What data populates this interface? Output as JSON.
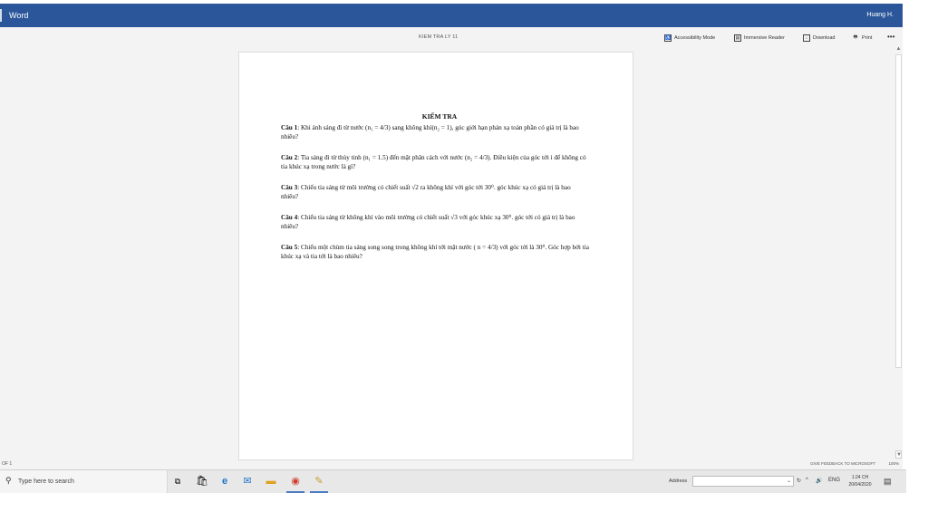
{
  "titlebar": {
    "app_name": "Word",
    "user_name": "Huang H."
  },
  "document": {
    "filename": "KIEM TRA LY 11",
    "heading": "KIỂM TRA",
    "questions": [
      {
        "label": "Câu 1",
        "text": ": Khi ánh sáng đi từ nước (n₁ = 4/3) sang không khí(n₂ = 1), góc giới hạn phản xạ toàn phần có giá trị là bao nhiêu?"
      },
      {
        "label": "Câu 2",
        "text": ": Tia sáng đi từ thủy tinh (n₁ = 1.5) đến mặt phân cách với nước (n₂ = 4/3). Điều kiện của góc tới i để không có tia khúc xạ trong nước là gì?"
      },
      {
        "label": "Câu 3",
        "text": ": Chiếu tia sáng từ môi trường có chiết suất √2 ra không khí với góc tới 30⁰. góc khúc xạ có giá trị là bao nhiêu?"
      },
      {
        "label": "Câu 4",
        "text": ": Chiếu tia sáng từ không khí vào môi trường có chiết suất √3 với góc khúc xạ 30⁰. góc tới có giá trị là bao nhiêu?"
      },
      {
        "label": "Câu 5",
        "text": ": Chiếu một chùm tia sáng song song trong không khí tới mặt nước ( n = 4/3) với góc tới là 30⁰. Góc hợp bởi tia khúc xạ và tia tới là bao nhiêu?"
      }
    ]
  },
  "commands": {
    "accessibility": "Accessibility Mode",
    "immersive": "Immersive Reader",
    "download": "Download",
    "print": "Print",
    "more": "•••"
  },
  "statusbar": {
    "page": "OF 1",
    "feedback": "GIVE FEEDBACK TO MICROSOFT",
    "zoom": "100%"
  },
  "taskbar": {
    "search_placeholder": "Type here to search",
    "address_label": "Address",
    "lang": "ENG",
    "time": "1:24 CH",
    "date": "20/04/2020"
  },
  "icons": {
    "search": "search-icon",
    "task_view": "task-view-icon",
    "store": "store-icon",
    "edge": "edge-icon",
    "mail": "mail-icon",
    "explorer": "file-explorer-icon",
    "chrome": "chrome-icon",
    "paint": "paint-icon"
  },
  "colors": {
    "titlebar": "#2b579a",
    "viewer_bg": "#f3f3f3"
  }
}
